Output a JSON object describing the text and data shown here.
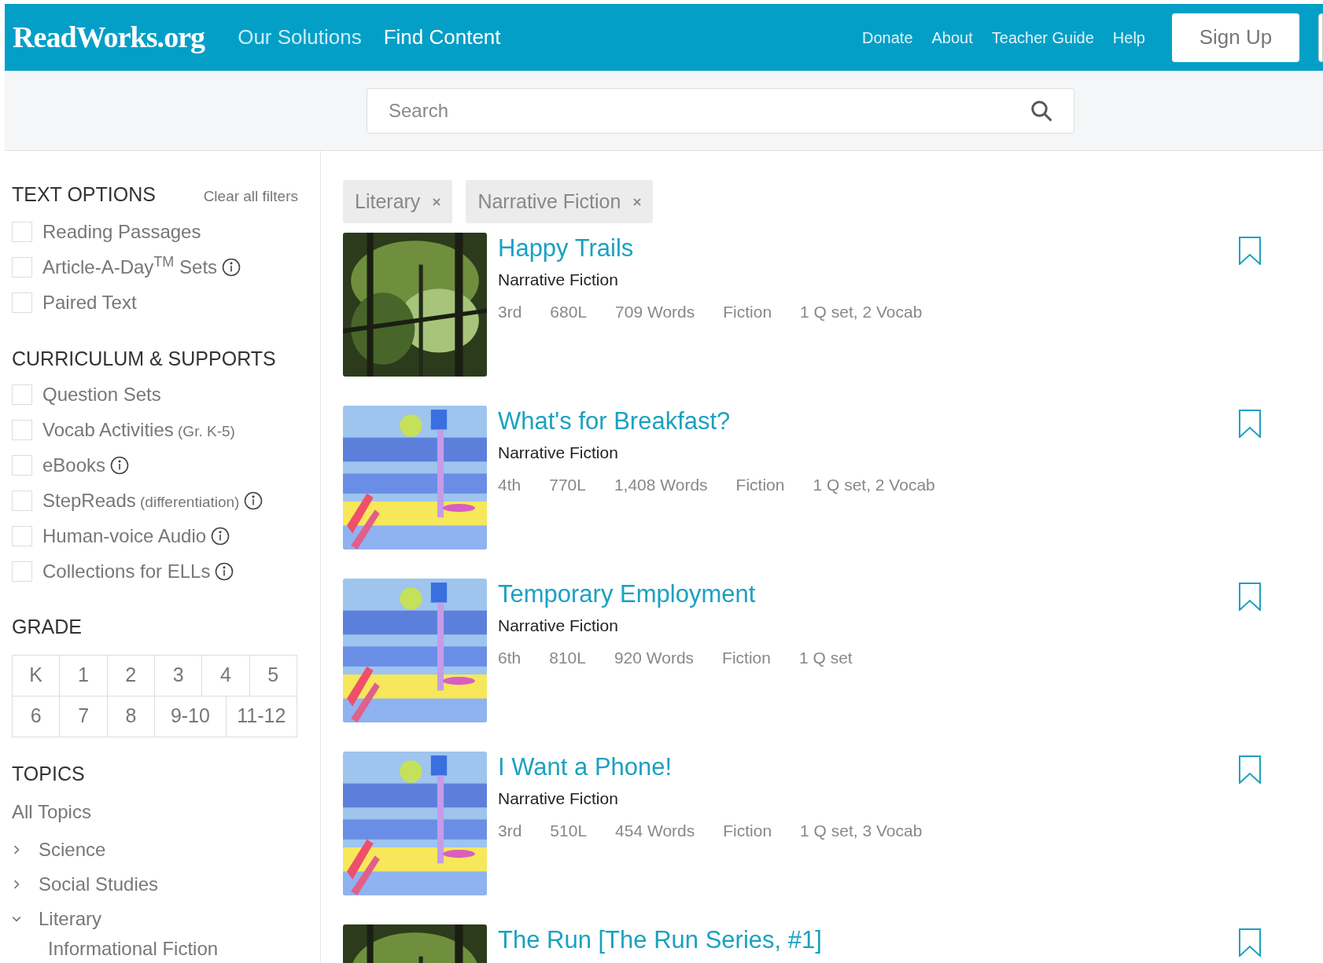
{
  "header": {
    "logo": "ReadWorks.org",
    "nav": [
      {
        "label": "Our Solutions",
        "selected": false
      },
      {
        "label": "Find Content",
        "selected": true
      }
    ],
    "links": [
      "Donate",
      "About",
      "Teacher Guide",
      "Help"
    ],
    "sign_up": "Sign Up"
  },
  "search": {
    "placeholder": "Search"
  },
  "sidebar": {
    "text_options": {
      "title": "TEXT OPTIONS",
      "clear": "Clear all filters",
      "items": [
        {
          "label": "Reading Passages",
          "checked": false,
          "info": false
        },
        {
          "label": "Article-A-Day$^{TM}$ Sets",
          "checked": false,
          "info": true
        },
        {
          "label": "Paired Text",
          "checked": false,
          "info": false
        }
      ]
    },
    "curriculum": {
      "title": "CURRICULUM & SUPPORTS",
      "items": [
        {
          "label": "Question Sets",
          "checked": false,
          "info": false
        },
        {
          "label": "Vocab Activities",
          "note": "(Gr. K-5)",
          "checked": false,
          "info": false
        },
        {
          "label": "eBooks",
          "checked": false,
          "info": true
        },
        {
          "label": "StepReads",
          "note": "(differentiation)",
          "checked": false,
          "info": true
        },
        {
          "label": "Human-voice Audio",
          "checked": false,
          "info": true
        },
        {
          "label": "Collections for ELLs",
          "checked": false,
          "info": true
        }
      ]
    },
    "grade": {
      "title": "GRADE",
      "options": [
        {
          "label": "K",
          "selected": false
        },
        {
          "label": "1",
          "selected": false
        },
        {
          "label": "2",
          "selected": false
        },
        {
          "label": "3",
          "selected": false
        },
        {
          "label": "4",
          "selected": false
        },
        {
          "label": "5",
          "selected": false
        },
        {
          "label": "6",
          "selected": false
        },
        {
          "label": "7",
          "selected": false
        },
        {
          "label": "8",
          "selected": false
        },
        {
          "label": "9-10",
          "selected": false
        },
        {
          "label": "11-12",
          "selected": false
        }
      ]
    },
    "topics": {
      "title": "TOPICS",
      "all": "All Topics",
      "items": [
        {
          "label": "Science",
          "expanded": false
        },
        {
          "label": "Social Studies",
          "expanded": false
        },
        {
          "label": "Literary",
          "expanded": true,
          "children": [
            {
              "label": "Informational Fiction"
            }
          ]
        }
      ]
    }
  },
  "filters": [
    "Literary",
    "Narrative Fiction"
  ],
  "results": [
    {
      "title": "Happy Trails",
      "genre": "Narrative Fiction",
      "meta": [
        "3rd",
        "680L",
        "709 Words",
        "Fiction",
        "1 Q set, 2 Vocab"
      ]
    },
    {
      "title": "What's for Breakfast?",
      "genre": "Narrative Fiction",
      "meta": [
        "4th",
        "770L",
        "1,408 Words",
        "Fiction",
        "1 Q set, 2 Vocab"
      ]
    },
    {
      "title": "Temporary Employment",
      "genre": "Narrative Fiction",
      "meta": [
        "6th",
        "810L",
        "920 Words",
        "Fiction",
        "1 Q set"
      ]
    },
    {
      "title": "I Want a Phone!",
      "genre": "Narrative Fiction",
      "meta": [
        "3rd",
        "510L",
        "454 Words",
        "Fiction",
        "1 Q set, 3 Vocab"
      ]
    },
    {
      "title": "The Run [The Run Series, #1]"
    }
  ]
}
